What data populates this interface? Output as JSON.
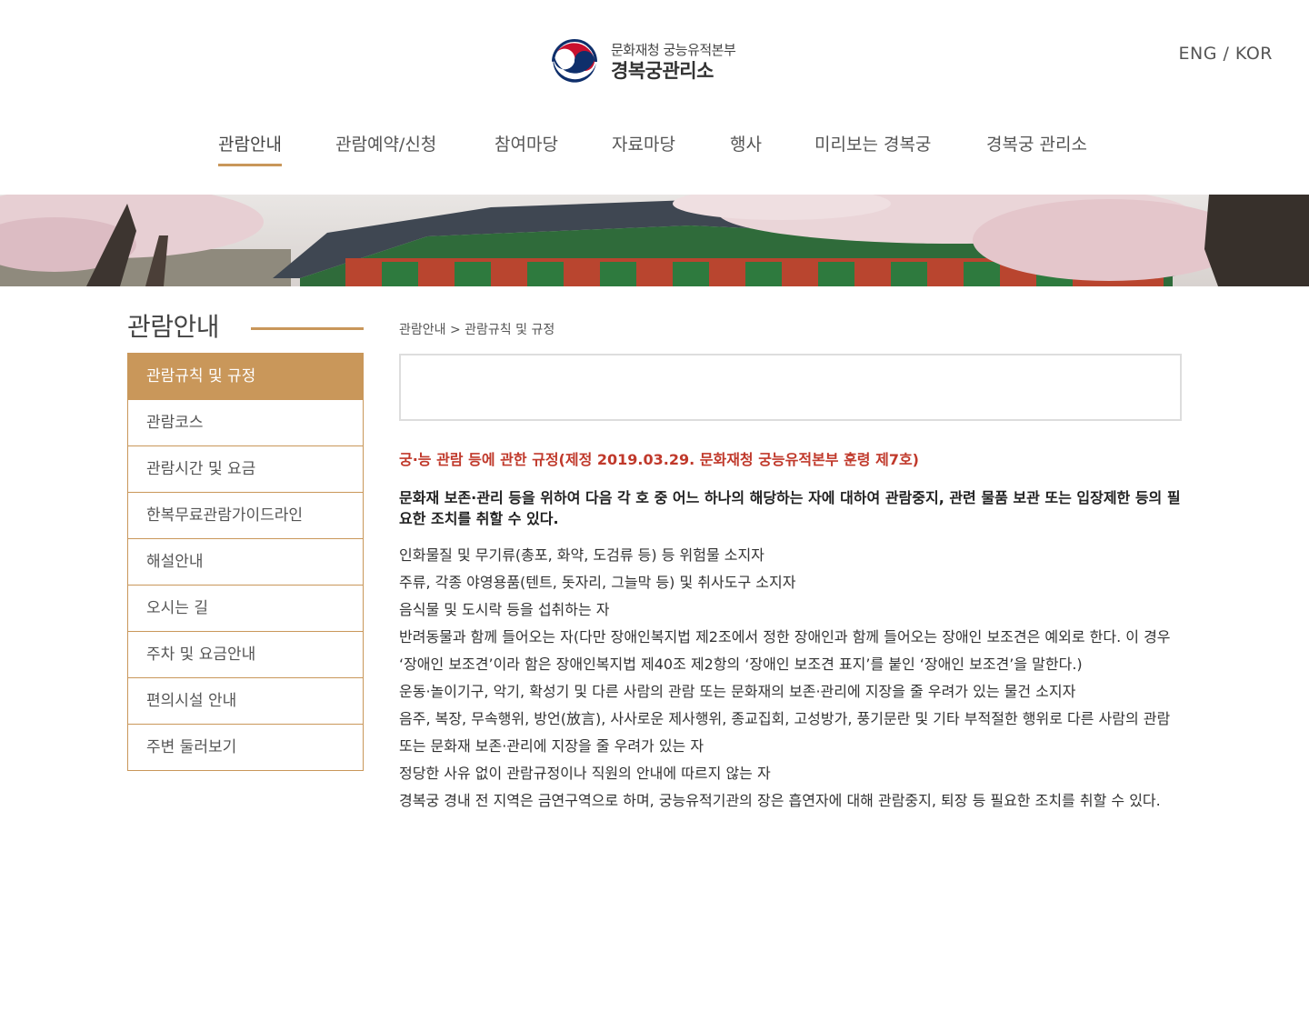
{
  "header": {
    "logo_line1": "문화재청 궁능유적본부",
    "logo_line2": "경복궁관리소",
    "lang": "ENG / KOR"
  },
  "nav": [
    {
      "label": "관람안내",
      "active": true
    },
    {
      "label": "관람예약/신청"
    },
    {
      "label": "참여마당"
    },
    {
      "label": "자료마당"
    },
    {
      "label": "행사"
    },
    {
      "label": "미리보는 경복궁"
    },
    {
      "label": "경복궁 관리소"
    }
  ],
  "sidebar": {
    "title": "관람안내",
    "items": [
      {
        "label": "관람규칙 및 규정",
        "active": true
      },
      {
        "label": "관람코스"
      },
      {
        "label": "관람시간 및 요금"
      },
      {
        "label": "한복무료관람가이드라인"
      },
      {
        "label": "해설안내"
      },
      {
        "label": "오시는 길"
      },
      {
        "label": "주차 및 요금안내"
      },
      {
        "label": "편의시설 안내"
      },
      {
        "label": "주변 둘러보기"
      }
    ]
  },
  "breadcrumb": "관람안내 > 관람규칙 및 규정",
  "content": {
    "reg_title": "궁·능 관람 등에 관한 규정(제정 2019.03.29. 문화재청 궁능유적본부 훈령 제7호)",
    "intro": "문화재 보존·관리 등을 위하여 다음 각 호 중 어느 하나의 해당하는 자에 대하여 관람중지, 관련 물품 보관 또는 입장제한 등의 필요한 조치를 취할 수 있다.",
    "rules": [
      "인화물질 및 무기류(총포, 화약, 도검류 등) 등 위험물 소지자",
      "주류, 각종 야영용품(텐트, 돗자리, 그늘막 등) 및 취사도구 소지자",
      "음식물 및 도시락 등을 섭취하는 자",
      "반려동물과 함께 들어오는 자(다만 장애인복지법 제2조에서 정한 장애인과 함께 들어오는 장애인 보조견은 예외로 한다. 이 경우 ‘장애인 보조견’이라 함은 장애인복지법 제40조 제2항의 ‘장애인 보조견 표지’를 붙인 ‘장애인 보조견’을 말한다.)",
      "운동·놀이기구, 악기, 확성기 및 다른 사람의 관람 또는 문화재의 보존·관리에 지장을 줄 우려가 있는 물건 소지자",
      "음주, 복장, 무속행위, 방언(放言), 사사로운 제사행위, 종교집회, 고성방가, 풍기문란 및 기타 부적절한 행위로 다른 사람의 관람 또는 문화재 보존·관리에 지장을 줄 우려가 있는 자",
      "정당한 사유 없이 관람규정이나 직원의 안내에 따르지 않는 자",
      "경복궁 경내 전 지역은 금연구역으로 하며, 궁능유적기관의 장은 흡연자에 대해 관람중지, 퇴장 등 필요한 조치를 취할 수 있다."
    ]
  },
  "colors": {
    "accent": "#c9975a",
    "title_red": "#c0392b"
  },
  "icons": {
    "logo": "taegeuk-emblem-icon"
  }
}
